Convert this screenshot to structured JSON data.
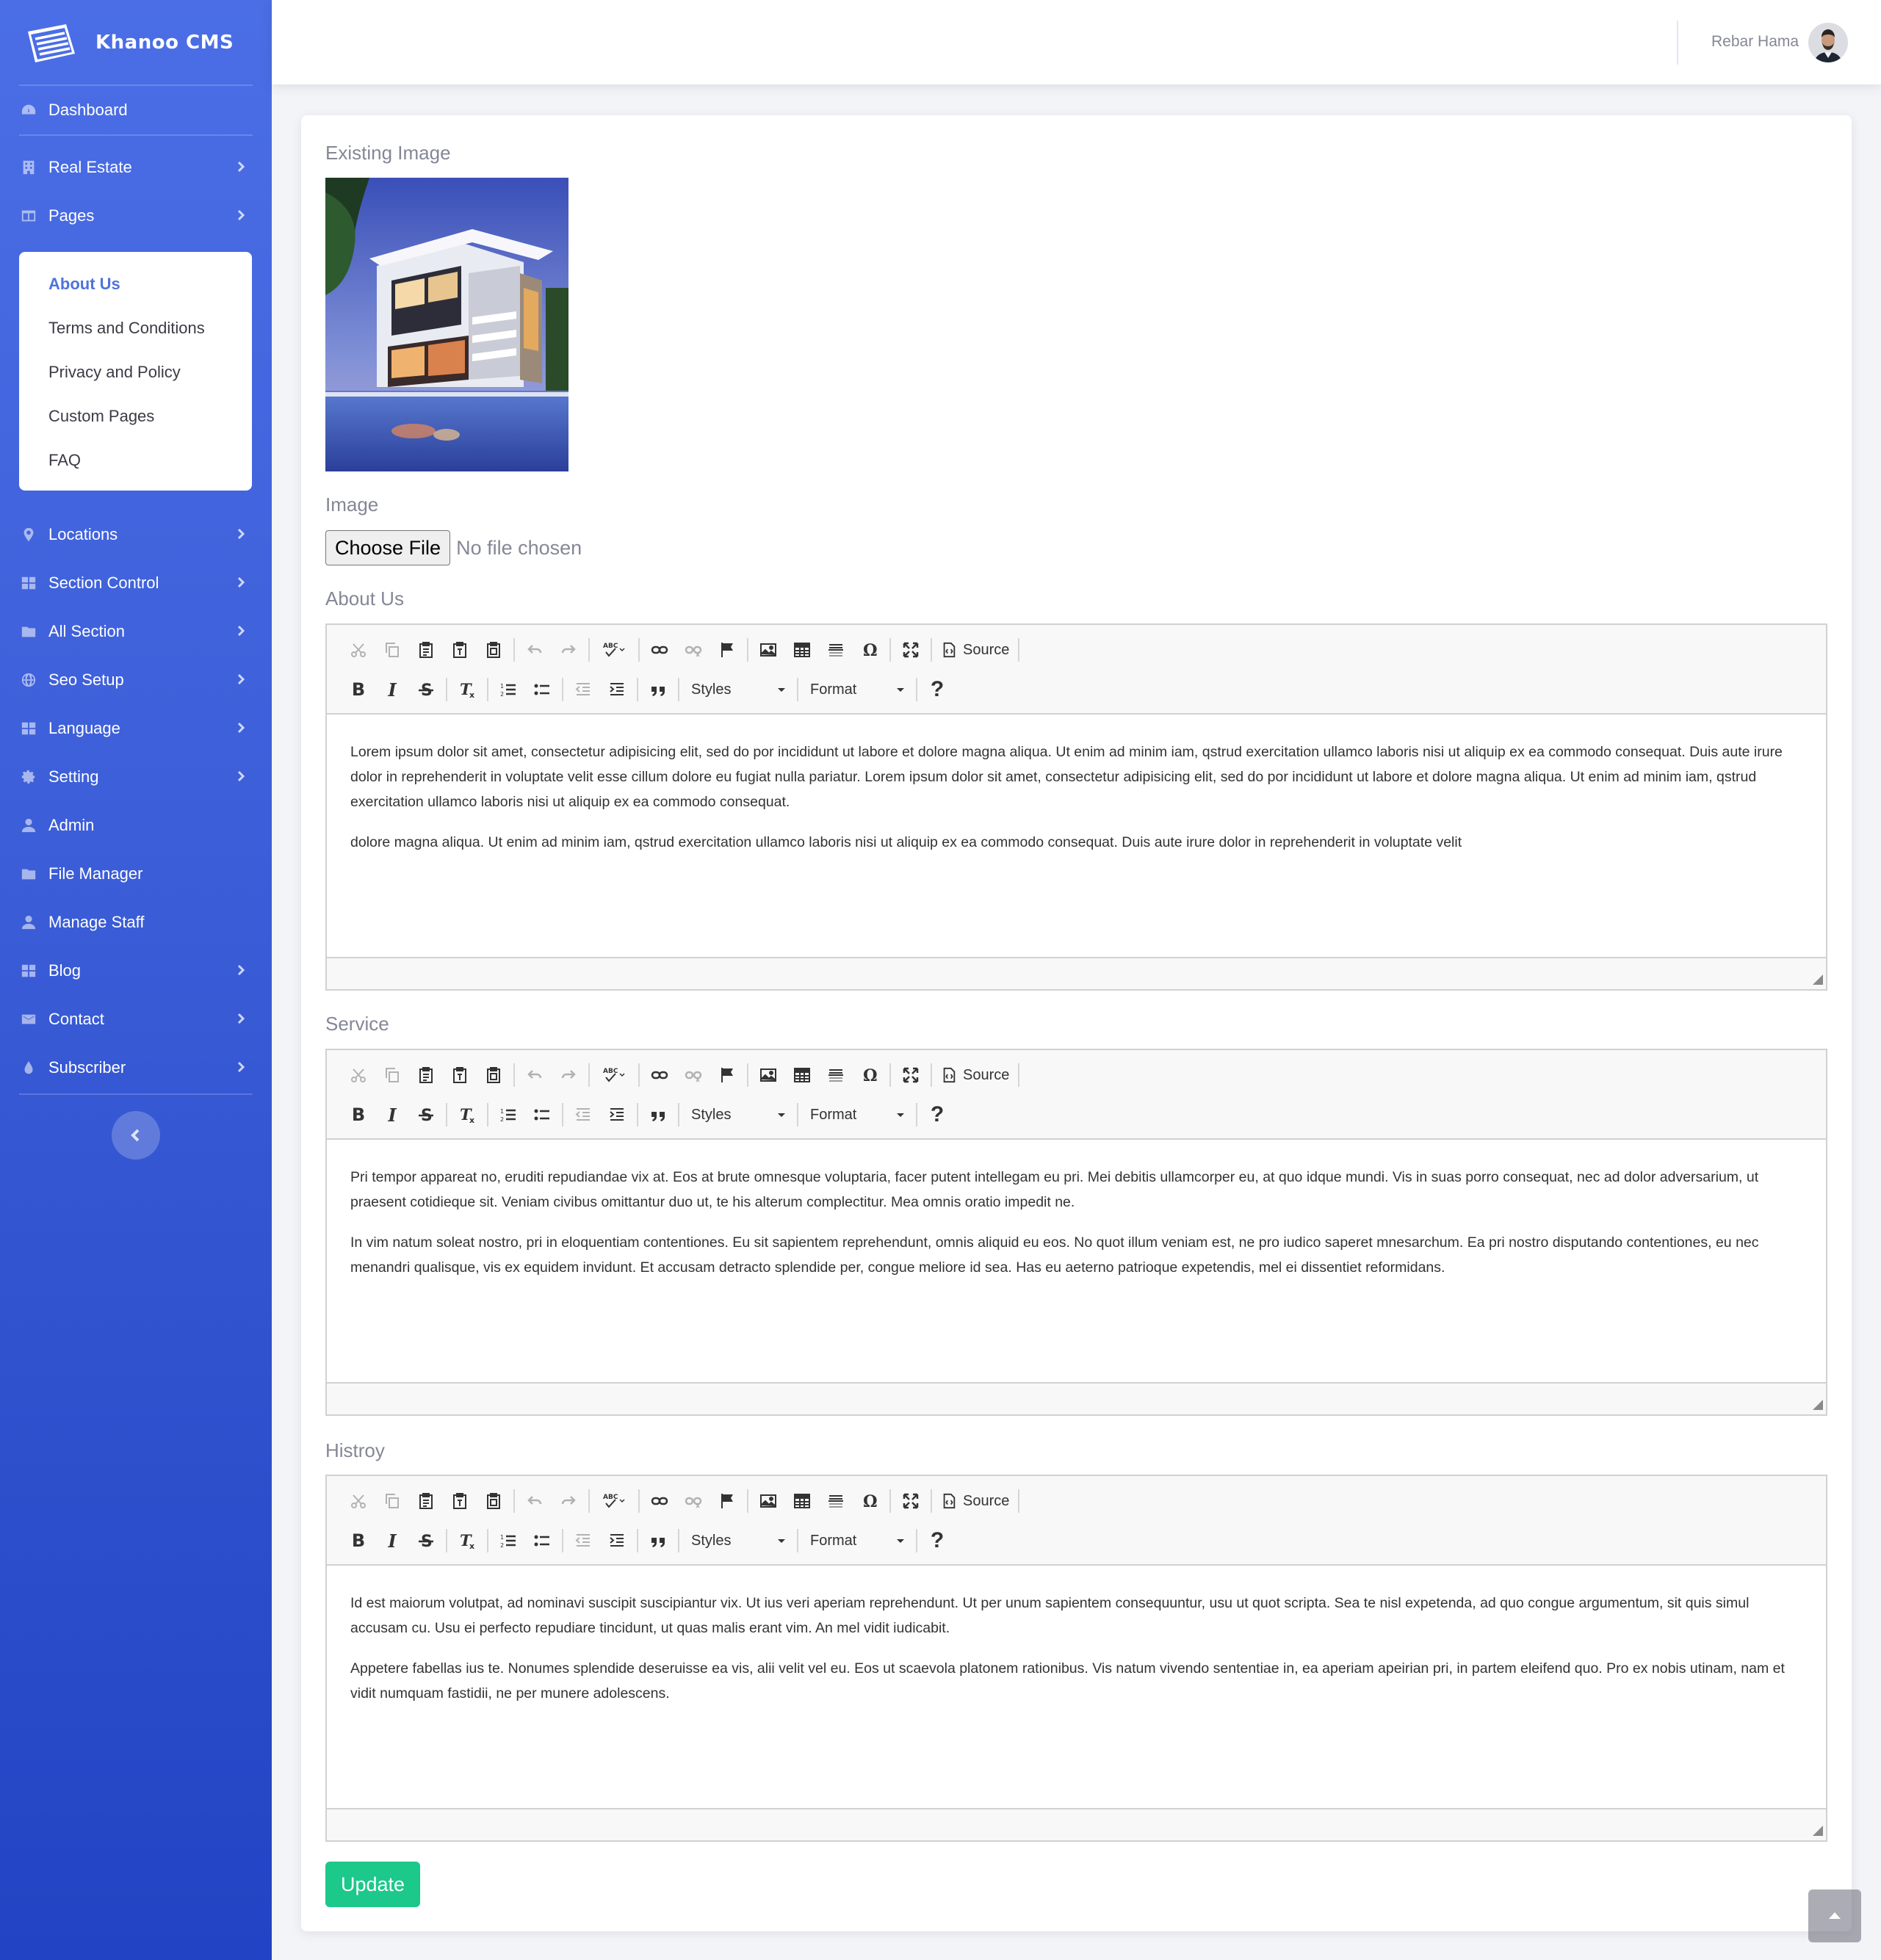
{
  "brand": {
    "name": "Khanoo CMS"
  },
  "sidebar": {
    "dashboard": "Dashboard",
    "real_estate": "Real Estate",
    "pages": "Pages",
    "pages_submenu": [
      "About Us",
      "Terms and Conditions",
      "Privacy and Policy",
      "Custom Pages",
      "FAQ"
    ],
    "active_subitem": "About Us",
    "items": [
      "Locations",
      "Section Control",
      "All Section",
      "Seo Setup",
      "Language",
      "Setting",
      "Admin",
      "File Manager",
      "Manage Staff",
      "Blog",
      "Contact",
      "Subscriber"
    ]
  },
  "topbar": {
    "user_name": "Rebar Hama"
  },
  "form": {
    "existing_image_label": "Existing Image",
    "image_label": "Image",
    "choose_file": "Choose File",
    "no_file": "No file chosen",
    "update_button": "Update"
  },
  "toolbar": {
    "source": "Source",
    "styles": "Styles",
    "format": "Format"
  },
  "editors": [
    {
      "label": "About Us",
      "paragraphs": [
        "Lorem ipsum dolor sit amet, consectetur adipisicing elit, sed do por incididunt ut labore et dolore magna aliqua. Ut enim ad minim iam, qstrud exercitation ullamco laboris nisi ut aliquip ex ea commodo consequat. Duis aute irure dolor in reprehenderit in voluptate velit esse cillum dolore eu fugiat nulla pariatur. Lorem ipsum dolor sit amet, consectetur adipisicing elit, sed do por incididunt ut labore et dolore magna aliqua. Ut enim ad minim iam, qstrud exercitation ullamco laboris nisi ut aliquip ex ea commodo consequat.",
        "dolore magna aliqua. Ut enim ad minim iam, qstrud exercitation ullamco laboris nisi ut aliquip ex ea commodo consequat. Duis aute irure dolor in reprehenderit in voluptate velit"
      ]
    },
    {
      "label": "Service",
      "paragraphs": [
        "Pri tempor appareat no, eruditi repudiandae vix at. Eos at brute omnesque voluptaria, facer putent intellegam eu pri. Mei debitis ullamcorper eu, at quo idque mundi. Vis in suas porro consequat, nec ad dolor adversarium, ut praesent cotidieque sit. Veniam civibus omittantur duo ut, te his alterum complectitur. Mea omnis oratio impedit ne.",
        "In vim natum soleat nostro, pri in eloquentiam contentiones. Eu sit sapientem reprehendunt, omnis aliquid eu eos. No quot illum veniam est, ne pro iudico saperet mnesarchum. Ea pri nostro disputando contentiones, eu nec menandri qualisque, vis ex equidem invidunt. Et accusam detracto splendide per, congue meliore id sea. Has eu aeterno patrioque expetendis, mel ei dissentiet reformidans."
      ]
    },
    {
      "label": "Histroy",
      "paragraphs": [
        "Id est maiorum volutpat, ad nominavi suscipit suscipiantur vix. Ut ius veri aperiam reprehendunt. Ut per unum sapientem consequuntur, usu ut quot scripta. Sea te nisl expetenda, ad quo congue argumentum, sit quis simul accusam cu. Usu ei perfecto repudiare tincidunt, ut quas malis erant vim. An mel vidit iudicabit.",
        "Appetere fabellas ius te. Nonumes splendide deseruisse ea vis, alii velit vel eu. Eos ut scaevola platonem rationibus. Vis natum vivendo sententiae in, ea aperiam apeirian pri, in partem eleifend quo. Pro ex nobis utinam, nam et vidit numquam fastidii, ne per munere adolescens."
      ]
    }
  ],
  "colors": {
    "sidebar_top": "#4b6ee6",
    "sidebar_bottom": "#2244c4",
    "accent": "#4e73df",
    "success": "#1cc88a"
  }
}
